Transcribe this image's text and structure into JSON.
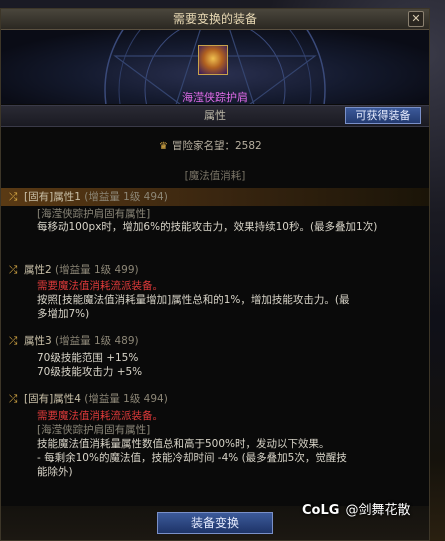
{
  "window": {
    "title": "需要变换的装备",
    "close_label": "✕"
  },
  "item": {
    "name": "海滢侠踪护肩",
    "name_color": "#e06be8"
  },
  "attributes_header": {
    "label": "属性",
    "obtainable_button": "可获得装备"
  },
  "adventurer": {
    "label": "冒险家名望：2582"
  },
  "magic_consumption_label": "[魔法值消耗]",
  "attributes": [
    {
      "title": "[固有]属性1",
      "gain": "(增益量 1级 494)",
      "lines": [
        {
          "text": "[海滢侠踪护肩固有属性]",
          "style": "gray"
        },
        {
          "text": "每移动100px时，增加6%的技能攻击力，效果持续10秒。(最多叠加1次)",
          "style": "normal"
        }
      ]
    },
    {
      "title": "属性2",
      "gain": "(增益量 1级 499)",
      "lines": [
        {
          "text": "需要魔法值消耗流派装备。",
          "style": "red"
        },
        {
          "text": "按照[技能魔法值消耗量增加]属性总和的1%，增加技能攻击力。(最",
          "style": "normal"
        },
        {
          "text": "多增加7%)",
          "style": "normal"
        }
      ]
    },
    {
      "title": "属性3",
      "gain": "(增益量 1级 489)",
      "lines": [
        {
          "text": "70级技能范围 +15%",
          "style": "normal"
        },
        {
          "text": "70级技能攻击力 +5%",
          "style": "normal"
        }
      ]
    },
    {
      "title": "[固有]属性4",
      "gain": "(增益量 1级 494)",
      "lines": [
        {
          "text": "需要魔法值消耗流派装备。",
          "style": "red"
        },
        {
          "text": "[海滢侠踪护肩固有属性]",
          "style": "gray"
        },
        {
          "text": "技能魔法值消耗量属性数值总和高于500%时，发动以下效果。",
          "style": "normal"
        },
        {
          "text": "- 每剩余10%的魔法值，技能冷却时间 -4% (最多叠加5次，觉醒技",
          "style": "normal"
        },
        {
          "text": "能除外)",
          "style": "normal"
        }
      ]
    }
  ],
  "footer": {
    "swap_button": "装备变换"
  },
  "watermark": {
    "logo": "CoLG",
    "text": "@剑舞花散"
  },
  "icons": {
    "shuffle": "shuffle-icon",
    "adventurer": "laurel-icon"
  }
}
